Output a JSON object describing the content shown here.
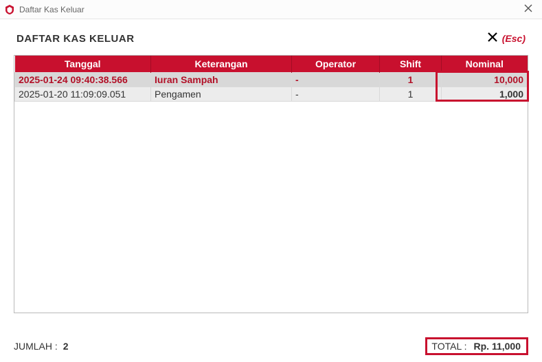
{
  "window": {
    "title": "Daftar Kas Keluar"
  },
  "header": {
    "title": "DAFTAR KAS KELUAR",
    "esc_label": "(Esc)"
  },
  "table": {
    "columns": {
      "tanggal": "Tanggal",
      "keterangan": "Keterangan",
      "operator": "Operator",
      "shift": "Shift",
      "nominal": "Nominal"
    },
    "rows": [
      {
        "tanggal": "2025-01-24 09:40:38.566",
        "keterangan": "Iuran Sampah",
        "operator": "-",
        "shift": "1",
        "nominal": "10,000",
        "selected": true
      },
      {
        "tanggal": "2025-01-20 11:09:09.051",
        "keterangan": "Pengamen",
        "operator": "-",
        "shift": "1",
        "nominal": "1,000",
        "selected": false
      }
    ]
  },
  "footer": {
    "jumlah_label": "JUMLAH :",
    "jumlah_value": "2",
    "total_label": "TOTAL :",
    "total_value": "Rp. 11,000"
  }
}
